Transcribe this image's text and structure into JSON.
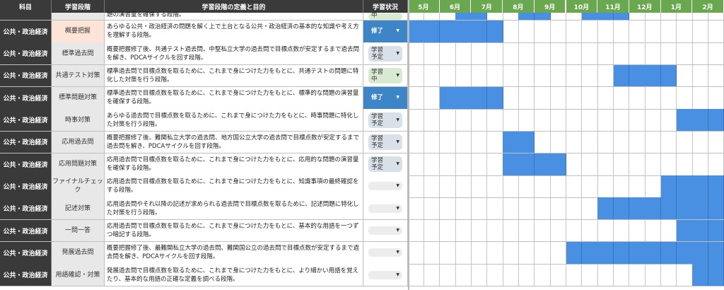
{
  "headers": {
    "subject": "科目",
    "phase": "学習段階",
    "definition": "学習段階の定義と目的",
    "status": "学習状況"
  },
  "months": [
    "5月",
    "6月",
    "7月",
    "8月",
    "9月",
    "10月",
    "11月",
    "12月",
    "1月",
    "2月"
  ],
  "colors": {
    "header_bg": "#3a3a3a",
    "month_header_bg": "#6aa84f",
    "gantt_fill": "#4a90e2",
    "done_bg": "#3d85c6"
  },
  "top_partial": {
    "definition": "題の演習量を確保する段階。",
    "status": "中",
    "fill": [
      0,
      0,
      0,
      1,
      1,
      0,
      0,
      1,
      1,
      0,
      0,
      1,
      1,
      1,
      0,
      0,
      0,
      0,
      0,
      0
    ]
  },
  "rows": [
    {
      "subject": "公共・政治経済",
      "phase": "概要把握",
      "definition": "あらゆる公共・政治経済の問題を解く上で土台となる公共・政治経済の基本的な知識や考え方を理解する段階。",
      "status": "修了",
      "status_type": "done",
      "fill": [
        1,
        1,
        1,
        1,
        1,
        1,
        0,
        0,
        0,
        0,
        0,
        0,
        0,
        0,
        0,
        0,
        0,
        0,
        0,
        0
      ]
    },
    {
      "subject": "公共・政治経済",
      "phase": "標準過去問",
      "definition": "概要把握修了後、共通テスト過去問、中堅私立大学の過去問で目標点数が安定するまで過去問を解き、PDCAサイクルを回す段階。",
      "status": "学習予定",
      "status_type": "plan",
      "fill": [
        0,
        0,
        0,
        0,
        0,
        0,
        0,
        0,
        0,
        0,
        0,
        0,
        0,
        0,
        0,
        0,
        0,
        0,
        0,
        0
      ]
    },
    {
      "subject": "公共・政治経済",
      "phase": "共通テスト対策",
      "definition": "標準過去問で目標点数を取るために、これまで身につけた力をもとに、共通テストの問題に特化した対策を行う段階。",
      "status": "学習中",
      "status_type": "now",
      "fill": [
        0,
        0,
        0,
        0,
        0,
        0,
        0,
        0,
        0,
        0,
        0,
        0,
        0,
        1,
        1,
        1,
        1,
        0,
        0,
        0
      ]
    },
    {
      "subject": "公共・政治経済",
      "phase": "標準問題対策",
      "definition": "標準過去問で目標点数を取るために、これまで身につけた力をもとに、標準的な問題の演習量を確保する段階。",
      "status": "修了",
      "status_type": "done",
      "fill": [
        0,
        0,
        1,
        1,
        1,
        1,
        0,
        0,
        0,
        0,
        0,
        0,
        0,
        0,
        0,
        0,
        0,
        0,
        0,
        0
      ]
    },
    {
      "subject": "公共・政治経済",
      "phase": "時事対策",
      "definition": "あらゆる過去問で目標点数を取るために、これまで身につけた力をもとに、時事問題に特化した対策を行う段階。",
      "status": "学習予定",
      "status_type": "plan",
      "fill": [
        0,
        0,
        0,
        0,
        0,
        0,
        0,
        0,
        0,
        0,
        0,
        0,
        0,
        0,
        0,
        0,
        0,
        1,
        1,
        1
      ]
    },
    {
      "subject": "公共・政治経済",
      "phase": "応用過去問",
      "definition": "概要把握修了後、難関私立大学の過去問、地方国公立大学の過去問で目標点数が安定するまで過去問を解き、PDCAサイクルを回す段階。",
      "status": "学習予定",
      "status_type": "plan",
      "fill": [
        0,
        0,
        0,
        0,
        0,
        0,
        1,
        1,
        0,
        0,
        0,
        0,
        0,
        0,
        0,
        0,
        0,
        0,
        0,
        0
      ]
    },
    {
      "subject": "公共・政治経済",
      "phase": "応用問題対策",
      "definition": "応用過去問で目標点数を取るために、これまで身につけた力をもとに、応用的な問題の演習量を確保する段階。",
      "status": "学習予定",
      "status_type": "plan",
      "fill": [
        0,
        0,
        0,
        0,
        0,
        0,
        1,
        1,
        1,
        1,
        0,
        0,
        0,
        0,
        0,
        0,
        0,
        0,
        0,
        0
      ]
    },
    {
      "subject": "公共・政治経済",
      "phase": "ファイナルチェック",
      "definition": "応用過去問で目標点数を取るために、これまで身につけた力をもとに、知識事項の最終確認をする段階。",
      "status": "",
      "status_type": "none",
      "fill": [
        0,
        0,
        0,
        0,
        0,
        0,
        0,
        0,
        0,
        0,
        0,
        0,
        0,
        0,
        0,
        0,
        1,
        1,
        1,
        1
      ]
    },
    {
      "subject": "公共・政治経済",
      "phase": "記述対策",
      "definition": "応用過去問やそれ以降の記述が求められる過去問で目標点数を取るために、記述問題に特化した対策を行う段階。",
      "status": "",
      "status_type": "none",
      "fill": [
        0,
        0,
        0,
        0,
        0,
        0,
        0,
        0,
        0,
        0,
        0,
        0,
        1,
        1,
        1,
        1,
        1,
        1,
        1,
        1
      ]
    },
    {
      "subject": "公共・政治経済",
      "phase": "一問一答",
      "definition": "応用過去問で目標点数を取るために、これまで身につけた力をもとに、基本的な用語を一つずつ暗記する段階。",
      "status": "",
      "status_type": "none",
      "fill": [
        0,
        0,
        0,
        0,
        0,
        0,
        0,
        0,
        0,
        0,
        0,
        0,
        0,
        0,
        0,
        0,
        0,
        1,
        1,
        1
      ]
    },
    {
      "subject": "公共・政治経済",
      "phase": "発展過去問",
      "definition": "概要把握修了後、最難関私立大学の過去問、難関国公立の過去問で目標点数が安定するまで過去問を解き、PDCAサイクルを回す段階。",
      "status": "",
      "status_type": "none",
      "fill": [
        0,
        0,
        0,
        0,
        0,
        0,
        0,
        0,
        0,
        0,
        1,
        1,
        1,
        1,
        1,
        1,
        1,
        1,
        1,
        1
      ]
    },
    {
      "subject": "公共・政治経済",
      "phase": "用語確認・対策",
      "definition": "発展過去問で目標点数を取るために、これまで身につけた力をもとに、より細かい用語を覚えたり、基本的な用語の正確な定義を調べる段階。",
      "status": "",
      "status_type": "none",
      "fill": [
        0,
        0,
        0,
        0,
        0,
        0,
        0,
        0,
        0,
        0,
        0,
        0,
        0,
        0,
        0,
        0,
        0,
        0,
        1,
        1
      ]
    }
  ]
}
